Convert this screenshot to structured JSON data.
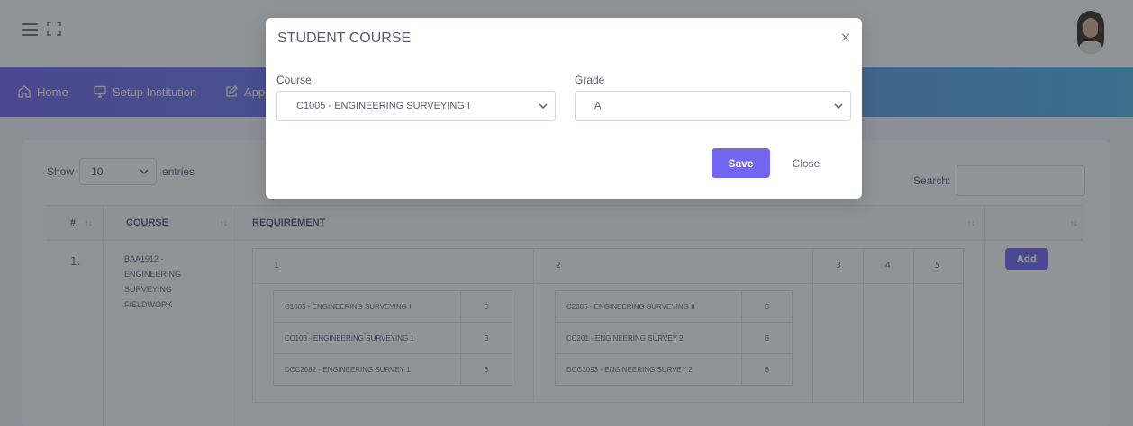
{
  "nav": {
    "home": "Home",
    "setup_institution": "Setup Institution",
    "app": "App"
  },
  "table_controls": {
    "show": "Show",
    "entries_value": "10",
    "entries": "entries",
    "search": "Search:"
  },
  "table": {
    "headers": [
      "#",
      "COURSE",
      "REQUIREMENT"
    ],
    "rows": [
      {
        "num": "1.",
        "course": "BAA1912 - ENGINEERING SURVEYING FIELDWORK",
        "add": "Add",
        "requirement_columns": [
          "1",
          "2",
          "3",
          "4",
          "5"
        ],
        "group1": [
          {
            "course": "C1005 - ENGINEERING SURVEYING I",
            "grade": "B"
          },
          {
            "course": "CC103 - ENGINEERING SURVEYING 1",
            "grade": "B"
          },
          {
            "course": "DCC2082 - ENGINEERING SURVEY 1",
            "grade": "B"
          }
        ],
        "group2": [
          {
            "course": "C2005 - ENGINEERING SURVEYING II",
            "grade": "B"
          },
          {
            "course": "CC201 - ENGINEERING SURVEY 2",
            "grade": "B"
          },
          {
            "course": "DCC3093 - ENGINEERING SURVEY 2",
            "grade": "B"
          }
        ]
      }
    ]
  },
  "modal": {
    "title": "STUDENT COURSE",
    "close_icon": "×",
    "course_label": "Course",
    "course_value": "C1005 - ENGINEERING SURVEYING I",
    "grade_label": "Grade",
    "grade_value": "A",
    "save": "Save",
    "close": "Close"
  },
  "colors": {
    "primary": "#7367f0",
    "nav_gradient_end": "#54b5e8",
    "overlay": "rgba(34,41,47,0.5)"
  }
}
